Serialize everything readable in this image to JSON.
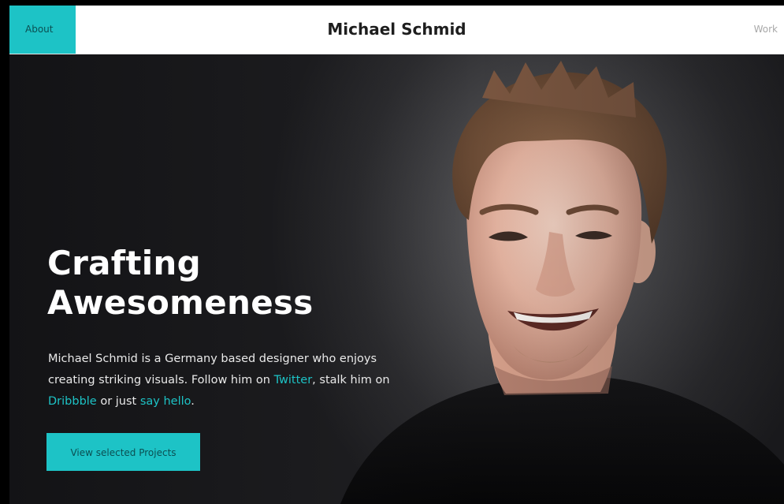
{
  "nav": {
    "about_label": "About",
    "site_title": "Michael Schmid",
    "work_label": "Work"
  },
  "hero": {
    "headline_line1": "Crafting",
    "headline_line2": "Awesomeness",
    "bio_part1": "Michael Schmid is a Germany based designer who enjoys creating striking visuals. Follow him on ",
    "twitter_link": "Twitter",
    "bio_part2": ", stalk him on ",
    "dribbble_link": "Dribbble",
    "bio_part3": " or just ",
    "hello_link": "say hello",
    "bio_part4": ".",
    "cta_label": "View selected Projects"
  },
  "colors": {
    "accent": "#1dc3c6",
    "hero_bg": "#1e1e21",
    "topbar_bg": "#ffffff"
  },
  "icons": {
    "portrait": "man-smiling-portrait"
  }
}
